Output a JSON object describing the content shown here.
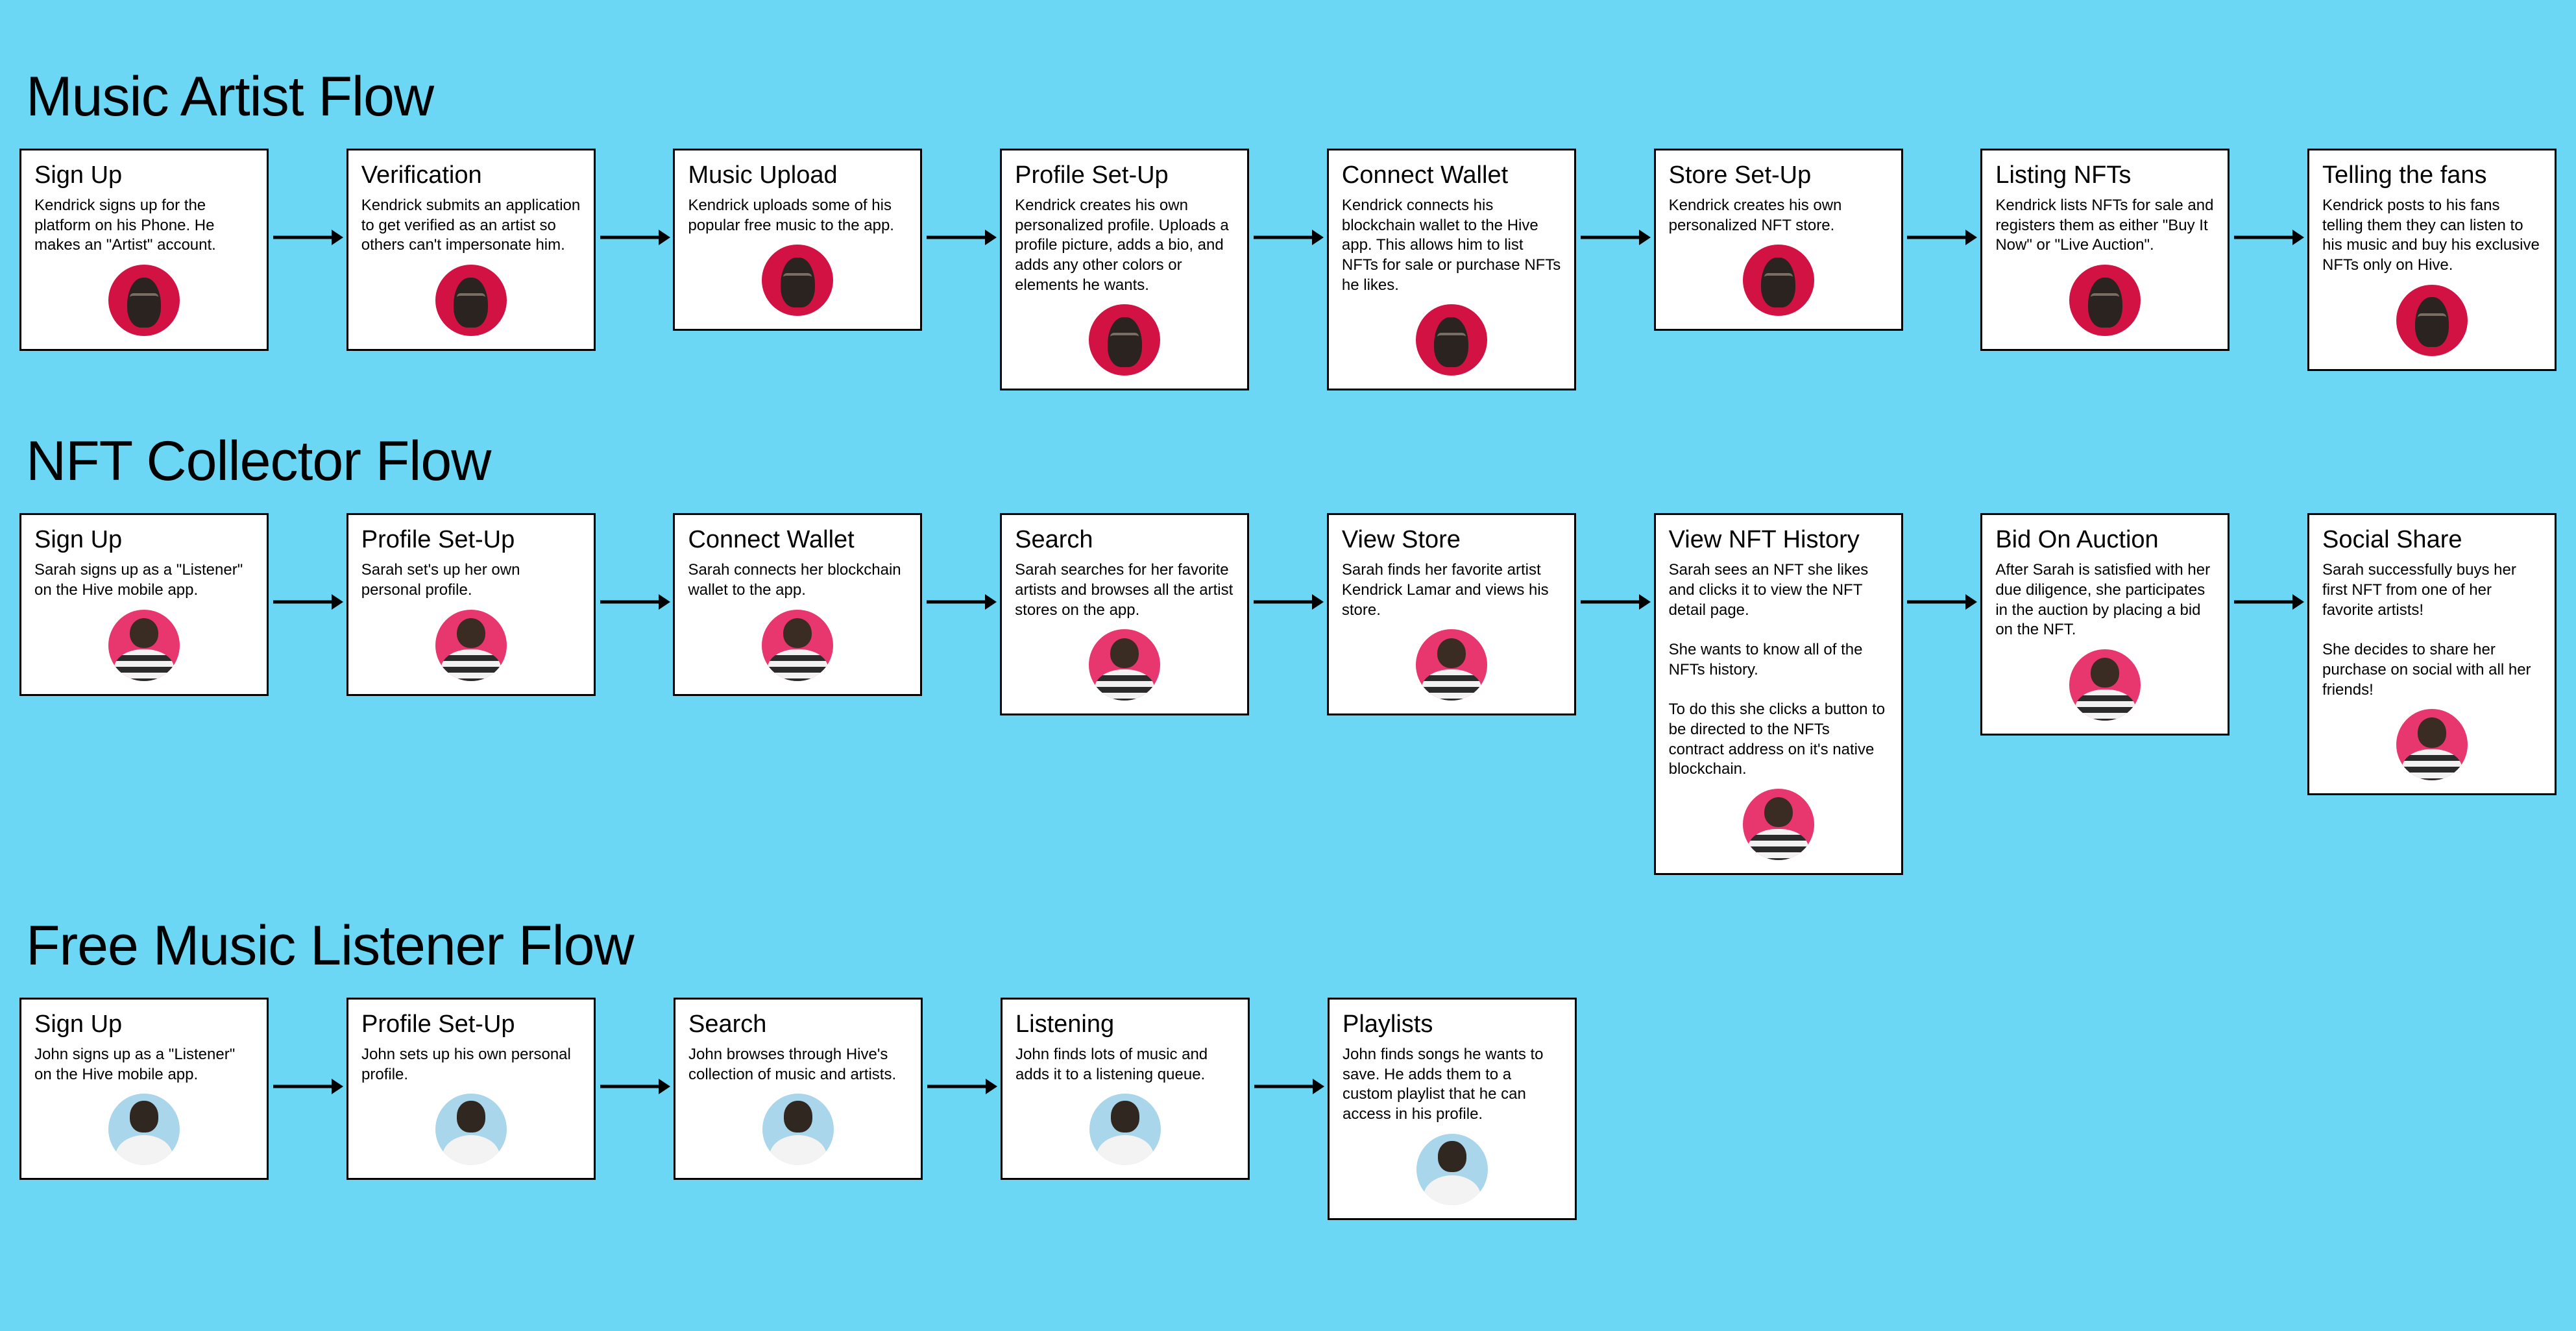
{
  "flows": [
    {
      "title": "Music Artist Flow",
      "avatar": "kendrick",
      "steps": [
        {
          "title": "Sign Up",
          "body": "Kendrick signs up for the platform on his Phone. He makes an \"Artist\" account."
        },
        {
          "title": "Verification",
          "body": "Kendrick submits an application to get verified as an artist so others can't impersonate him."
        },
        {
          "title": "Music Upload",
          "body": "Kendrick uploads some of his popular free music to the app."
        },
        {
          "title": "Profile Set-Up",
          "body": "Kendrick creates his own personalized profile. Uploads a profile picture, adds a bio, and adds any other colors or elements he wants."
        },
        {
          "title": "Connect Wallet",
          "body": "Kendrick connects his blockchain wallet to the Hive app. This allows him to list NFTs for sale or purchase NFTs he likes."
        },
        {
          "title": "Store Set-Up",
          "body": "Kendrick creates his own personalized NFT store."
        },
        {
          "title": "Listing NFTs",
          "body": "Kendrick lists NFTs for sale and registers them as either \"Buy It Now\" or \"Live Auction\"."
        },
        {
          "title": "Telling the fans",
          "body": "Kendrick posts to his fans telling them they can listen to his music and buy his exclusive NFTs only on Hive."
        }
      ]
    },
    {
      "title": "NFT Collector Flow",
      "avatar": "sarah",
      "steps": [
        {
          "title": "Sign Up",
          "body": "Sarah signs up as a \"Listener\" on the Hive mobile app."
        },
        {
          "title": "Profile Set-Up",
          "body": "Sarah set's up her own personal profile."
        },
        {
          "title": "Connect Wallet",
          "body": "Sarah connects her blockchain wallet to the app."
        },
        {
          "title": "Search",
          "body": "Sarah searches for her favorite artists and browses all the artist stores on the app."
        },
        {
          "title": "View Store",
          "body": "Sarah finds her favorite artist Kendrick Lamar and views his store."
        },
        {
          "title": "View NFT History",
          "body": "Sarah sees an NFT she likes and clicks it to view the NFT detail page.\n\nShe wants to know all of the NFTs history.\n\nTo do this she clicks a button to be directed to the NFTs contract address on it's native blockchain."
        },
        {
          "title": "Bid On Auction",
          "body": "After Sarah is satisfied with her due diligence, she participates in the auction by placing a bid on the NFT."
        },
        {
          "title": "Social Share",
          "body": "Sarah successfully buys her first NFT from one of her favorite artists!\n\nShe decides to share her purchase on social with all her friends!"
        }
      ]
    },
    {
      "title": "Free Music Listener Flow",
      "avatar": "john",
      "steps": [
        {
          "title": "Sign Up",
          "body": "John signs up as a \"Listener\" on the Hive mobile app."
        },
        {
          "title": "Profile Set-Up",
          "body": "John sets up his own personal profile."
        },
        {
          "title": "Search",
          "body": "John browses through Hive's collection of music and artists."
        },
        {
          "title": "Listening",
          "body": "John finds lots of music and adds it to a listening queue."
        },
        {
          "title": "Playlists",
          "body": "John finds songs he wants to save. He adds them to a custom playlist that he can access in his profile."
        }
      ]
    }
  ]
}
